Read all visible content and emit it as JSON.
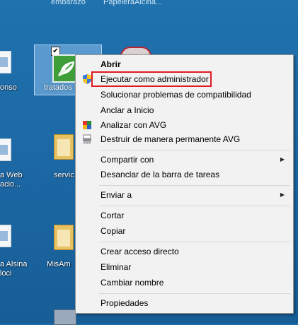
{
  "desktop": {
    "top_labels": [
      "embarazo",
      "PapeleraAlcina..."
    ],
    "icons": [
      {
        "label_line1": "onso",
        "label_line2": ""
      },
      {
        "label_line1": "a Web",
        "label_line2": "acio..."
      },
      {
        "label_line1": "servic",
        "label_line2": ""
      },
      {
        "label_line1": "a Alsina",
        "label_line2": "loci"
      },
      {
        "label_line1": "MisAm",
        "label_line2": ""
      }
    ],
    "selected_icon": {
      "label": "tratados",
      "checked": "✔",
      "icon": "leaf-app-icon"
    }
  },
  "context_menu": {
    "items": [
      {
        "label": "Abrir",
        "bold": true
      },
      {
        "label": "Ejecutar como administrador",
        "icon": "uac-shield-icon",
        "highlighted": true
      },
      {
        "label": "Solucionar problemas de compatibilidad"
      },
      {
        "label": "Anclar a Inicio"
      },
      {
        "label": "Analizar con AVG",
        "icon": "avg-icon"
      },
      {
        "label": "Destruir de manera permanente AVG",
        "icon": "shredder-icon"
      },
      {
        "label": "Compartir con",
        "submenu": true
      },
      {
        "label": "Desanclar de la barra de tareas"
      },
      {
        "label": "Enviar a",
        "submenu": true
      },
      {
        "label": "Cortar"
      },
      {
        "label": "Copiar"
      },
      {
        "label": "Crear acceso directo"
      },
      {
        "label": "Eliminar"
      },
      {
        "label": "Cambiar nombre"
      },
      {
        "label": "Propiedades"
      }
    ],
    "submenu_arrow": "▶",
    "highlight_color": "#e01a22"
  }
}
